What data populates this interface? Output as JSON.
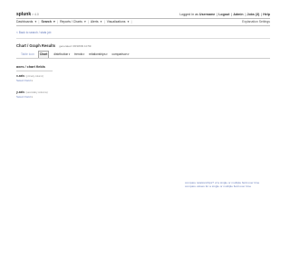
{
  "app": {
    "logo": "splunk",
    "version": "> 4.0"
  },
  "userbar": {
    "logged_in_as": "Logged in as",
    "username": "Username",
    "logout": "Logout",
    "admin": "Admin",
    "jobs": "Jobs (3)",
    "help": "Help"
  },
  "nav": {
    "items": [
      {
        "label": "Dashboards",
        "caret": "▾",
        "active": false
      },
      {
        "label": "Search",
        "caret": "▾",
        "active": true
      },
      {
        "label": "Reports / Charts",
        "caret": "▾",
        "active": false
      },
      {
        "label": "Alerts",
        "caret": "▾",
        "active": false
      },
      {
        "label": "Visualizations",
        "caret": "▾",
        "active": false
      }
    ],
    "explain": "Explanation Settings"
  },
  "back_link": "< Back to search / stats job",
  "results": {
    "title": "Chart / Graph Results",
    "generated": "generated: 08/18/09 10:59"
  },
  "toolbar": {
    "lead_label": "Table icon",
    "tab_active": "Chart",
    "dropdowns": [
      "distribution",
      "trends",
      "relationships",
      "comparison"
    ],
    "caret": "▾"
  },
  "fields": {
    "heading": "axes / chart fields",
    "x": {
      "label": "x-axis",
      "hint": "(primary column)",
      "fn": "Select Field",
      "caret": "▾"
    },
    "y": {
      "label": "y-axis",
      "hint": "(secondary columns)",
      "fn": "Select Field",
      "caret": "▾"
    }
  },
  "footer": {
    "line1": "compare relationships? of a single or multiple field over time",
    "line2": "compare values for a single or multiple field over time"
  }
}
